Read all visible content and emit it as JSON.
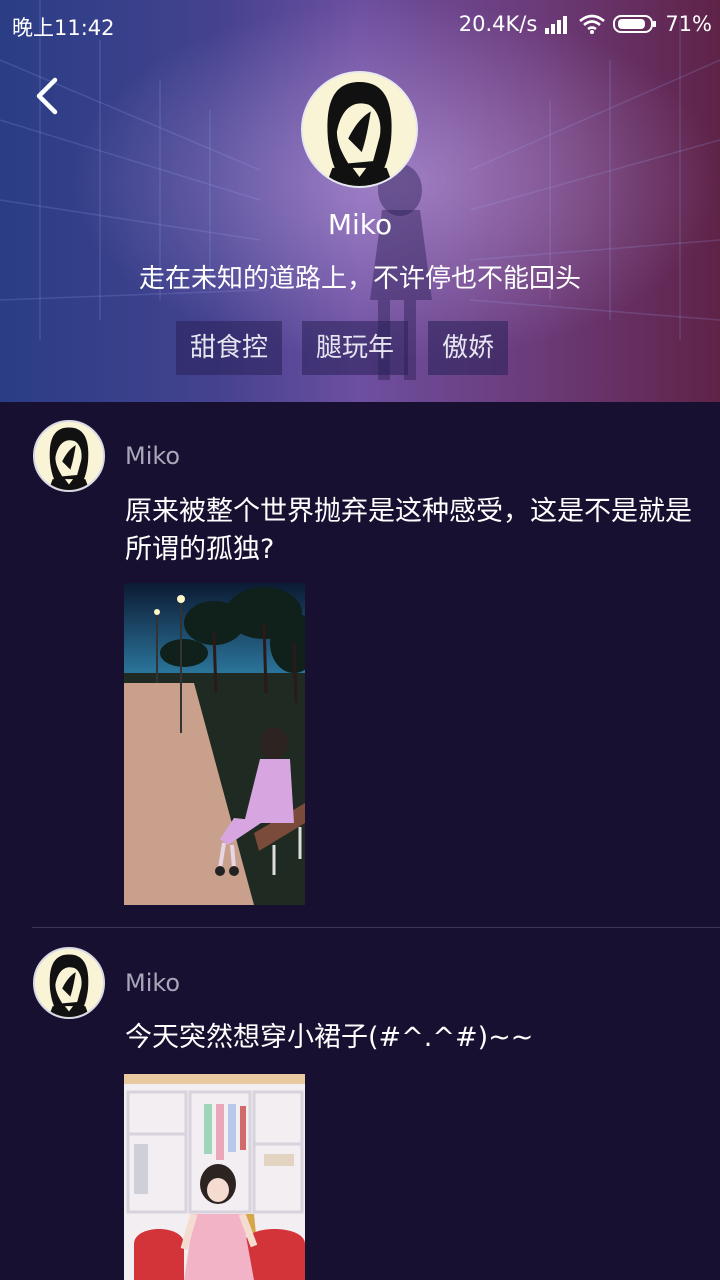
{
  "status_bar": {
    "time": "晚上11:42",
    "network_speed": "20.4K/s",
    "battery": "71%",
    "icons": [
      "signal-icon",
      "wifi-icon",
      "battery-icon"
    ]
  },
  "header": {
    "back_icon": "chevron-left-icon",
    "name": "Miko",
    "bio": "走在未知的道路上，不许停也不能回头",
    "tags": [
      "甜食控",
      "腿玩年",
      "傲娇"
    ]
  },
  "posts": [
    {
      "author": "Miko",
      "text": "原来被整个世界抛弃是这种感受，这是不是就是所谓的孤独?"
    },
    {
      "author": "Miko",
      "text": "今天突然想穿小裙子(#^.^#)~~"
    }
  ],
  "colors": {
    "feed_background": "#181030",
    "header_gradient_left": "#2a3d85",
    "header_gradient_right": "#5f2348",
    "muted_text": "#a8a6b8"
  }
}
